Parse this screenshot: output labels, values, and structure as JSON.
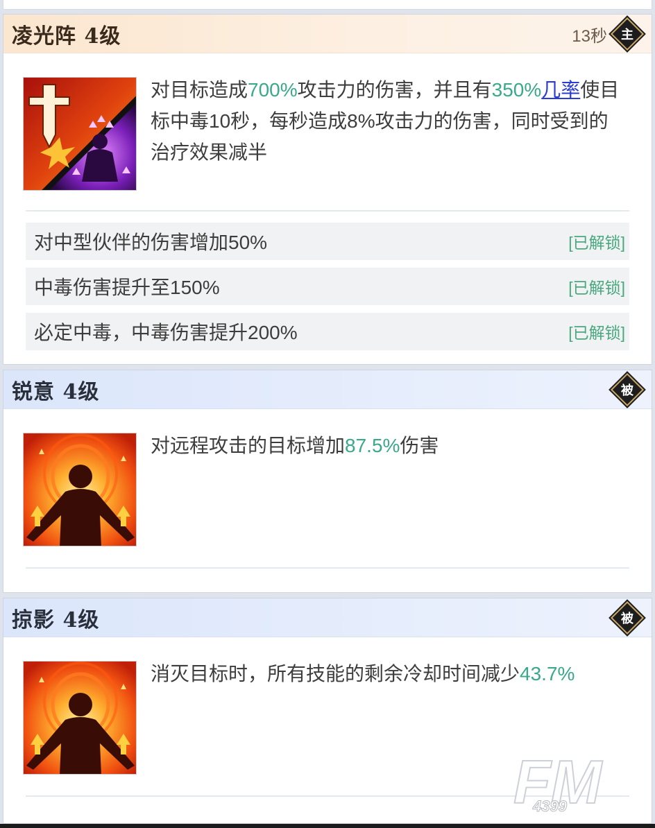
{
  "skills": [
    {
      "name": "凌光阵 4级",
      "cooldown": "13秒",
      "badge": "主",
      "icon": "light-array-skill-icon",
      "desc": {
        "p1": "对目标造成",
        "v1": "700%",
        "p2": "攻击力的伤害，并且有",
        "v2": "350%",
        "link": "几率",
        "p3": "使目标中毒10秒，每秒造成8%攻击力的伤害，同时受到的治疗效果减半"
      },
      "unlocks": [
        {
          "text": "对中型伙伴的伤害增加50%",
          "status": "[已解锁]"
        },
        {
          "text": "中毒伤害提升至150%",
          "status": "[已解锁]"
        },
        {
          "text": "必定中毒，中毒伤害提升200%",
          "status": "[已解锁]"
        }
      ]
    },
    {
      "name": "锐意 4级",
      "badge": "被",
      "icon": "power-up-figure-icon",
      "desc": {
        "p1": "对远程攻击的目标增加",
        "v1": "87.5%",
        "p2": "伤害"
      }
    },
    {
      "name": "掠影 4级",
      "badge": "被",
      "icon": "power-up-figure-icon",
      "desc": {
        "p1": "消灭目标时，所有技能的剩余冷却时间减少",
        "v1": "43.7%"
      }
    }
  ],
  "watermark": {
    "big": "FM",
    "small": "4399"
  },
  "colors": {
    "highlight": "#3aa88a",
    "link": "#2b3bd6",
    "unlocked": "#49a87e"
  }
}
